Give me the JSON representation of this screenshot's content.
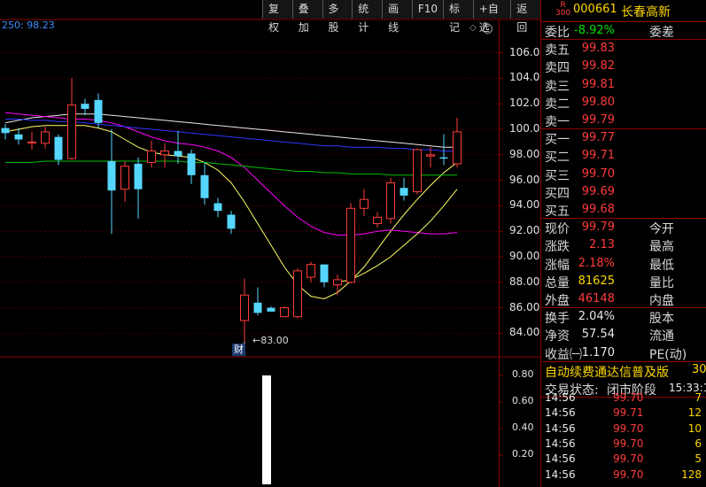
{
  "toolbar": {
    "items": [
      "复权",
      "叠加",
      "多股",
      "统计",
      "画线",
      "F10",
      "标记",
      "+自选",
      "返回"
    ]
  },
  "ma_label": "250: 98.23",
  "chart_data": {
    "type": "candlestick",
    "ylim": [
      82.5,
      107.5
    ],
    "yticks": [
      "106.00",
      "104.00",
      "102.00",
      "100.00",
      "98.00",
      "96.00",
      "94.00",
      "92.00",
      "90.00",
      "88.00",
      "86.00",
      "84.00"
    ],
    "volume_ticks": [
      "0.80",
      "0.60",
      "0.40",
      "0.20"
    ],
    "candles": [
      {
        "o": 100.1,
        "h": 100.4,
        "l": 99.2,
        "c": 99.7
      },
      {
        "o": 99.6,
        "h": 100.1,
        "l": 98.8,
        "c": 99.2
      },
      {
        "o": 99.0,
        "h": 99.8,
        "l": 98.4,
        "c": 99.0
      },
      {
        "o": 98.9,
        "h": 100.2,
        "l": 98.5,
        "c": 99.8
      },
      {
        "o": 99.4,
        "h": 99.6,
        "l": 97.2,
        "c": 97.6
      },
      {
        "o": 97.7,
        "h": 104.0,
        "l": 97.6,
        "c": 101.9
      },
      {
        "o": 102.0,
        "h": 102.4,
        "l": 101.1,
        "c": 101.6
      },
      {
        "o": 102.3,
        "h": 102.8,
        "l": 100.1,
        "c": 100.5
      },
      {
        "o": 97.5,
        "h": 100.0,
        "l": 91.8,
        "c": 95.2
      },
      {
        "o": 95.3,
        "h": 97.5,
        "l": 94.3,
        "c": 97.1
      },
      {
        "o": 97.3,
        "h": 97.8,
        "l": 93.0,
        "c": 95.3
      },
      {
        "o": 97.4,
        "h": 99.1,
        "l": 97.0,
        "c": 98.3
      },
      {
        "o": 98.0,
        "h": 98.9,
        "l": 97.0,
        "c": 98.3
      },
      {
        "o": 98.3,
        "h": 99.9,
        "l": 97.3,
        "c": 97.9
      },
      {
        "o": 98.1,
        "h": 98.4,
        "l": 95.7,
        "c": 96.4
      },
      {
        "o": 96.4,
        "h": 97.4,
        "l": 94.1,
        "c": 94.6
      },
      {
        "o": 94.2,
        "h": 94.6,
        "l": 93.1,
        "c": 93.6
      },
      {
        "o": 93.3,
        "h": 93.6,
        "l": 91.8,
        "c": 92.2
      },
      {
        "o": 85.0,
        "h": 88.3,
        "l": 83.0,
        "c": 87.0
      },
      {
        "o": 86.4,
        "h": 87.6,
        "l": 85.4,
        "c": 85.6
      },
      {
        "o": 86.0,
        "h": 86.1,
        "l": 85.7,
        "c": 85.7
      },
      {
        "o": 85.3,
        "h": 86.1,
        "l": 85.3,
        "c": 86.0
      },
      {
        "o": 85.3,
        "h": 89.1,
        "l": 85.2,
        "c": 88.9
      },
      {
        "o": 88.4,
        "h": 89.6,
        "l": 88.0,
        "c": 89.4
      },
      {
        "o": 89.4,
        "h": 89.4,
        "l": 87.6,
        "c": 88.0
      },
      {
        "o": 87.8,
        "h": 88.6,
        "l": 87.0,
        "c": 88.2
      },
      {
        "o": 88.0,
        "h": 94.2,
        "l": 87.9,
        "c": 93.8
      },
      {
        "o": 93.8,
        "h": 95.3,
        "l": 93.2,
        "c": 94.5
      },
      {
        "o": 92.6,
        "h": 93.5,
        "l": 92.3,
        "c": 93.1
      },
      {
        "o": 93.0,
        "h": 96.2,
        "l": 92.6,
        "c": 95.8
      },
      {
        "o": 95.4,
        "h": 96.2,
        "l": 94.4,
        "c": 94.8
      },
      {
        "o": 95.1,
        "h": 98.5,
        "l": 94.9,
        "c": 98.4
      },
      {
        "o": 97.9,
        "h": 98.6,
        "l": 97.0,
        "c": 98.0
      },
      {
        "o": 97.8,
        "h": 99.6,
        "l": 97.2,
        "c": 97.7
      },
      {
        "o": 97.3,
        "h": 100.9,
        "l": 97.0,
        "c": 99.8
      }
    ],
    "ma_lines": [
      {
        "color": "#e8e8e8",
        "values": [
          100.5,
          100.7,
          100.9,
          101.0,
          101.1,
          101.2,
          101.2,
          101.2,
          101.1,
          101.0,
          100.9,
          100.8,
          100.7,
          100.6,
          100.5,
          100.4,
          100.3,
          100.2,
          100.1,
          100.0,
          99.9,
          99.8,
          99.7,
          99.6,
          99.5,
          99.4,
          99.3,
          99.2,
          99.1,
          99.0,
          98.9,
          98.8,
          98.7,
          98.6,
          98.6
        ]
      },
      {
        "color": "#ffff66",
        "values": [
          99.8,
          100.0,
          100.2,
          100.3,
          100.3,
          100.3,
          100.3,
          100.1,
          99.8,
          99.2,
          98.6,
          98.2,
          98.0,
          97.9,
          97.8,
          97.4,
          96.8,
          95.8,
          94.3,
          92.6,
          90.9,
          89.2,
          87.8,
          86.9,
          86.7,
          87.2,
          88.1,
          89.2,
          90.6,
          92.0,
          93.3,
          94.5,
          95.6,
          96.6,
          97.4
        ]
      },
      {
        "color": "#ff00ff",
        "values": [
          101.3,
          101.2,
          101.1,
          101.0,
          100.9,
          100.8,
          100.8,
          100.7,
          100.5,
          100.2,
          99.8,
          99.4,
          99.1,
          98.9,
          98.8,
          98.6,
          98.3,
          97.8,
          97.0,
          96.0,
          95.0,
          94.0,
          93.1,
          92.4,
          91.9,
          91.7,
          91.7,
          91.8,
          92.0,
          92.1,
          92.0,
          91.9,
          91.8,
          91.8,
          91.9
        ]
      },
      {
        "color": "#2f36ff",
        "values": [
          100.8,
          100.8,
          100.7,
          100.7,
          100.6,
          100.6,
          100.5,
          100.4,
          100.3,
          100.2,
          100.1,
          100.0,
          99.9,
          99.8,
          99.7,
          99.6,
          99.5,
          99.4,
          99.3,
          99.2,
          99.1,
          99.0,
          98.9,
          98.8,
          98.7,
          98.7,
          98.6,
          98.6,
          98.6,
          98.5,
          98.5,
          98.4,
          98.4,
          98.3,
          98.3
        ]
      },
      {
        "color": "#00c000",
        "values": [
          97.4,
          97.4,
          97.4,
          97.5,
          97.5,
          97.5,
          97.5,
          97.5,
          97.5,
          97.5,
          97.5,
          97.5,
          97.5,
          97.5,
          97.4,
          97.4,
          97.3,
          97.2,
          97.1,
          97.0,
          96.9,
          96.8,
          96.7,
          96.7,
          96.6,
          96.6,
          96.5,
          96.5,
          96.5,
          96.4,
          96.4,
          96.4,
          96.4,
          96.4,
          96.4
        ]
      },
      {
        "color": "#ffff66",
        "values": [
          null,
          null,
          null,
          null,
          null,
          null,
          null,
          null,
          null,
          null,
          null,
          null,
          null,
          null,
          null,
          null,
          null,
          null,
          null,
          null,
          null,
          null,
          null,
          null,
          null,
          88.0,
          88.2,
          88.7,
          89.3,
          90.0,
          90.9,
          91.8,
          92.8,
          94.0,
          95.3
        ]
      }
    ],
    "low_marker": "83.00",
    "volume_bar": 0.82
  },
  "cai_badge": "财",
  "panel": {
    "r_badge": "R",
    "r_sub": "300",
    "code": "000661",
    "name": "长春高新",
    "weibi": {
      "label": "委比",
      "value": "-8.92%",
      "label2": "委差"
    },
    "sells": [
      {
        "label": "卖五",
        "price": "99.83"
      },
      {
        "label": "卖四",
        "price": "99.82"
      },
      {
        "label": "卖三",
        "price": "99.81"
      },
      {
        "label": "卖二",
        "price": "99.80"
      },
      {
        "label": "卖一",
        "price": "99.79"
      }
    ],
    "buys": [
      {
        "label": "买一",
        "price": "99.77"
      },
      {
        "label": "买二",
        "price": "99.71"
      },
      {
        "label": "买三",
        "price": "99.70"
      },
      {
        "label": "买四",
        "price": "99.69"
      },
      {
        "label": "买五",
        "price": "99.68"
      }
    ],
    "stats1": [
      {
        "k": "现价",
        "v": "99.79",
        "k2": "今开",
        "cls": "red"
      },
      {
        "k": "涨跌",
        "v": "2.13",
        "k2": "最高",
        "cls": "red"
      },
      {
        "k": "涨幅",
        "v": "2.18%",
        "k2": "最低",
        "cls": "red"
      },
      {
        "k": "总量",
        "v": "81625",
        "k2": "量比",
        "cls": "yellow"
      },
      {
        "k": "外盘",
        "v": "46148",
        "k2": "内盘",
        "cls": "red"
      }
    ],
    "stats2": [
      {
        "k": "换手",
        "v": "2.04%",
        "k2": "股本",
        "cls": "white"
      },
      {
        "k": "净资",
        "v": "57.54",
        "k2": "流通",
        "cls": "white"
      },
      {
        "k": "收益㈠",
        "v": "1.170",
        "k2": "PE(动)",
        "cls": "white"
      }
    ],
    "ad": {
      "text": "自动续费通达信普及版",
      "num": "30"
    },
    "status": {
      "label": "交易状态:",
      "value": "闭市阶段",
      "time": "15:33:1"
    },
    "ticks": [
      {
        "t": "14:56",
        "p": "99.70",
        "q": "7"
      },
      {
        "t": "14:56",
        "p": "99.71",
        "q": "12"
      },
      {
        "t": "14:56",
        "p": "99.70",
        "q": "10"
      },
      {
        "t": "14:56",
        "p": "99.70",
        "q": "6"
      },
      {
        "t": "14:56",
        "p": "99.70",
        "q": "5"
      },
      {
        "t": "14:56",
        "p": "99.70",
        "q": "128"
      }
    ]
  }
}
